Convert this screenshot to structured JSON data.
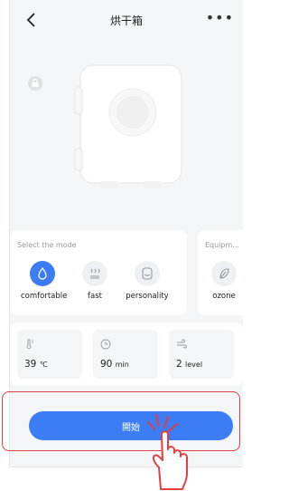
{
  "header": {
    "title": "烘干箱",
    "more_label": "•••"
  },
  "mode_card": {
    "caption": "Select the mode",
    "modes": [
      {
        "label": "comfortable",
        "icon": "drop-icon",
        "active": true
      },
      {
        "label": "fast",
        "icon": "heat-waves-icon",
        "active": false
      },
      {
        "label": "personality",
        "icon": "smile-icon",
        "active": false
      }
    ]
  },
  "equipment_card": {
    "caption": "Equipm...",
    "item_label": "ozone",
    "icon": "leaf-icon"
  },
  "stats": [
    {
      "icon": "thermometer-icon",
      "value": "39",
      "unit": "℃"
    },
    {
      "icon": "clock-icon",
      "value": "90",
      "unit": "min"
    },
    {
      "icon": "wind-icon",
      "value": "2",
      "unit": "level"
    }
  ],
  "start_button": {
    "label": "開始"
  },
  "colors": {
    "accent": "#3c7df5",
    "highlight": "#e04040"
  }
}
